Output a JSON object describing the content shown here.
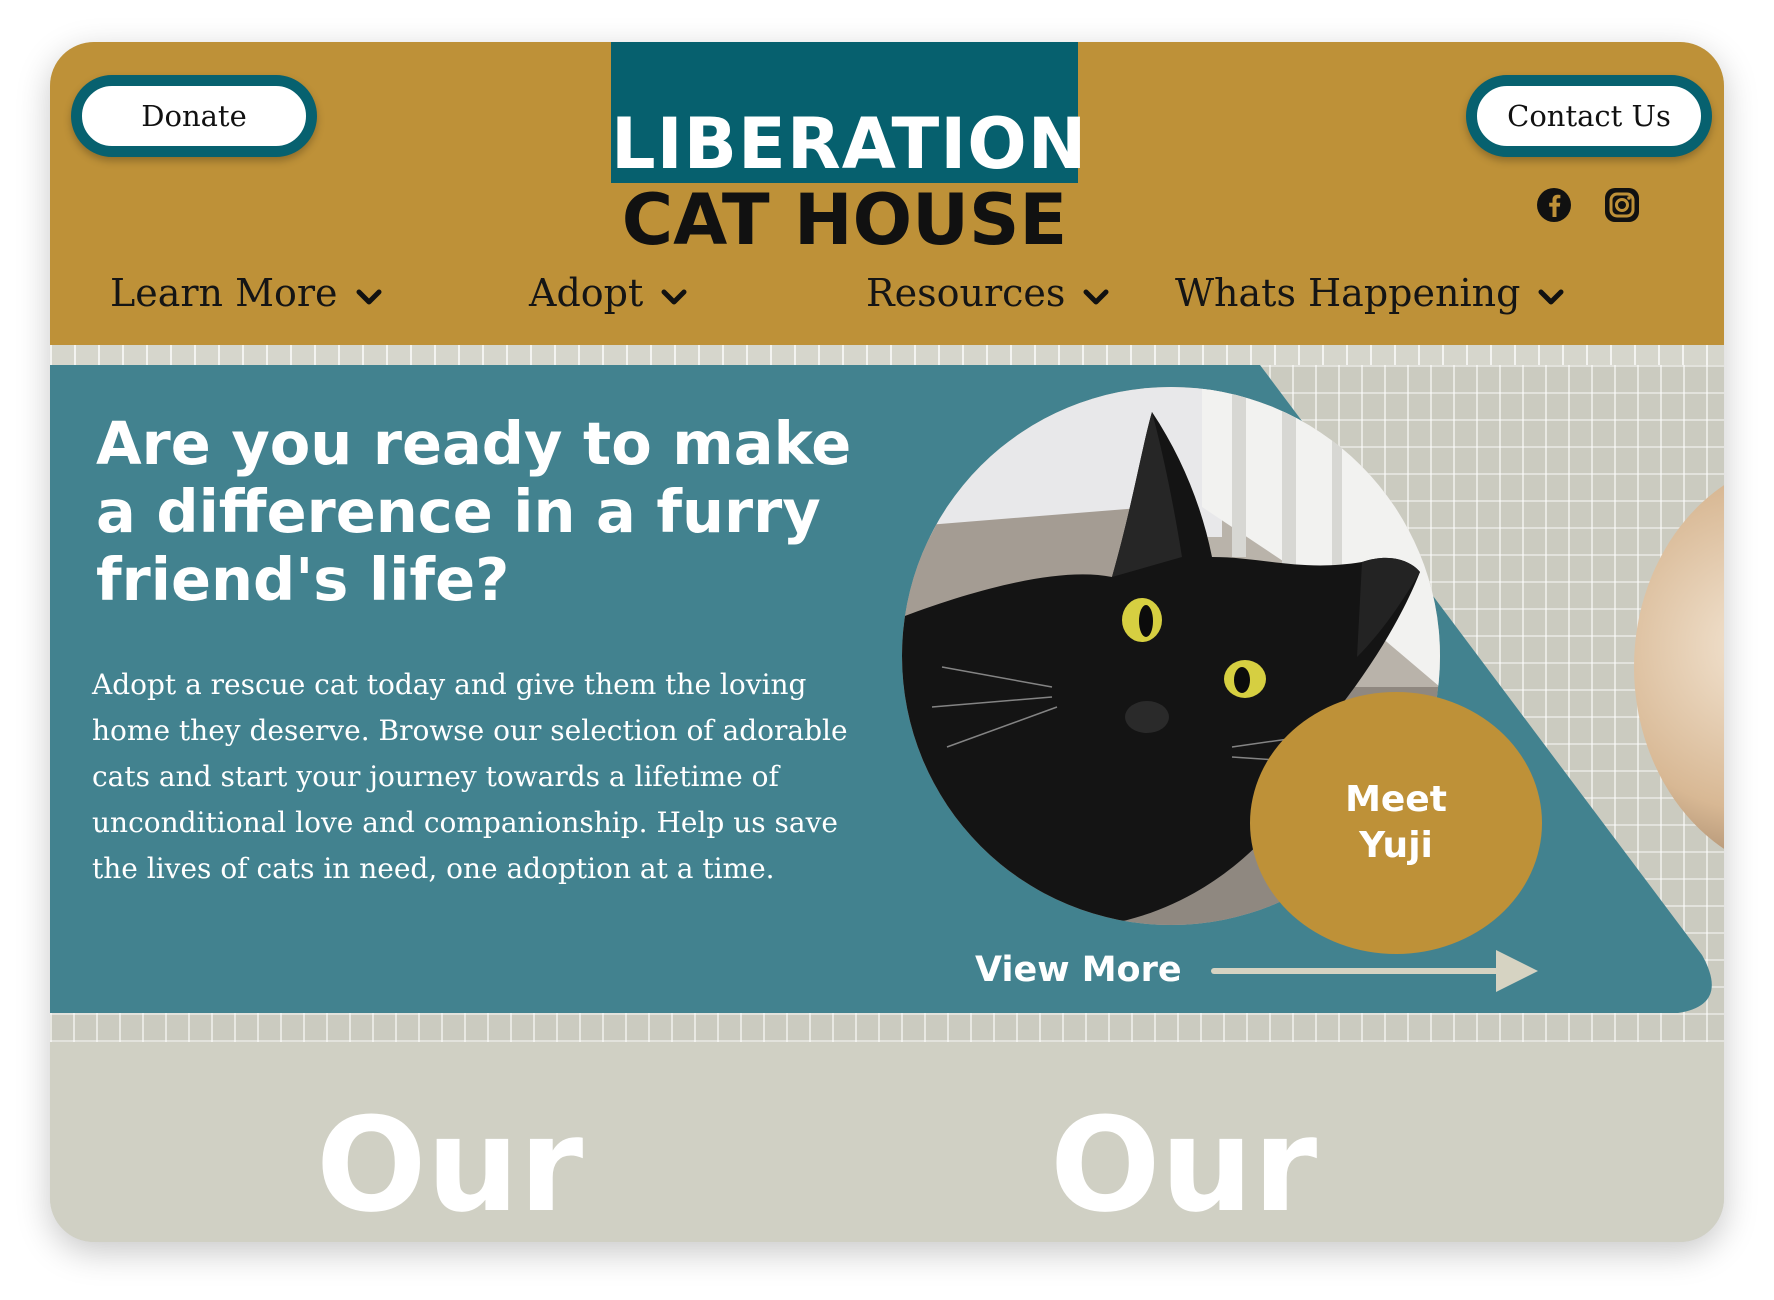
{
  "header": {
    "donate_label": "Donate",
    "contact_label": "Contact Us",
    "logo_line1": "LIBERATION",
    "logo_line2": "CAT HOUSE",
    "social_icons": [
      "facebook-icon",
      "instagram-icon"
    ],
    "nav": [
      {
        "label": "Learn More"
      },
      {
        "label": "Adopt"
      },
      {
        "label": "Resources"
      },
      {
        "label": "Whats Happening"
      }
    ]
  },
  "hero": {
    "title": "Are you ready to make a difference in a furry friend's life?",
    "body": "Adopt a rescue cat today and give them the loving home they deserve. Browse our selection of adorable cats and start your journey towards a lifetime of unconditional love and companionship. Help us save the lives of cats in need, one adoption at a time.",
    "meet_line1": "Meet",
    "meet_line2": "Yuji",
    "view_more": "View More"
  },
  "bottom": {
    "heading_left": "Our",
    "heading_right": "Our"
  },
  "colors": {
    "mustard": "#be9138",
    "dark_teal": "#06606e",
    "hero_teal": "#42828f",
    "stone": "#d0d0c4"
  }
}
